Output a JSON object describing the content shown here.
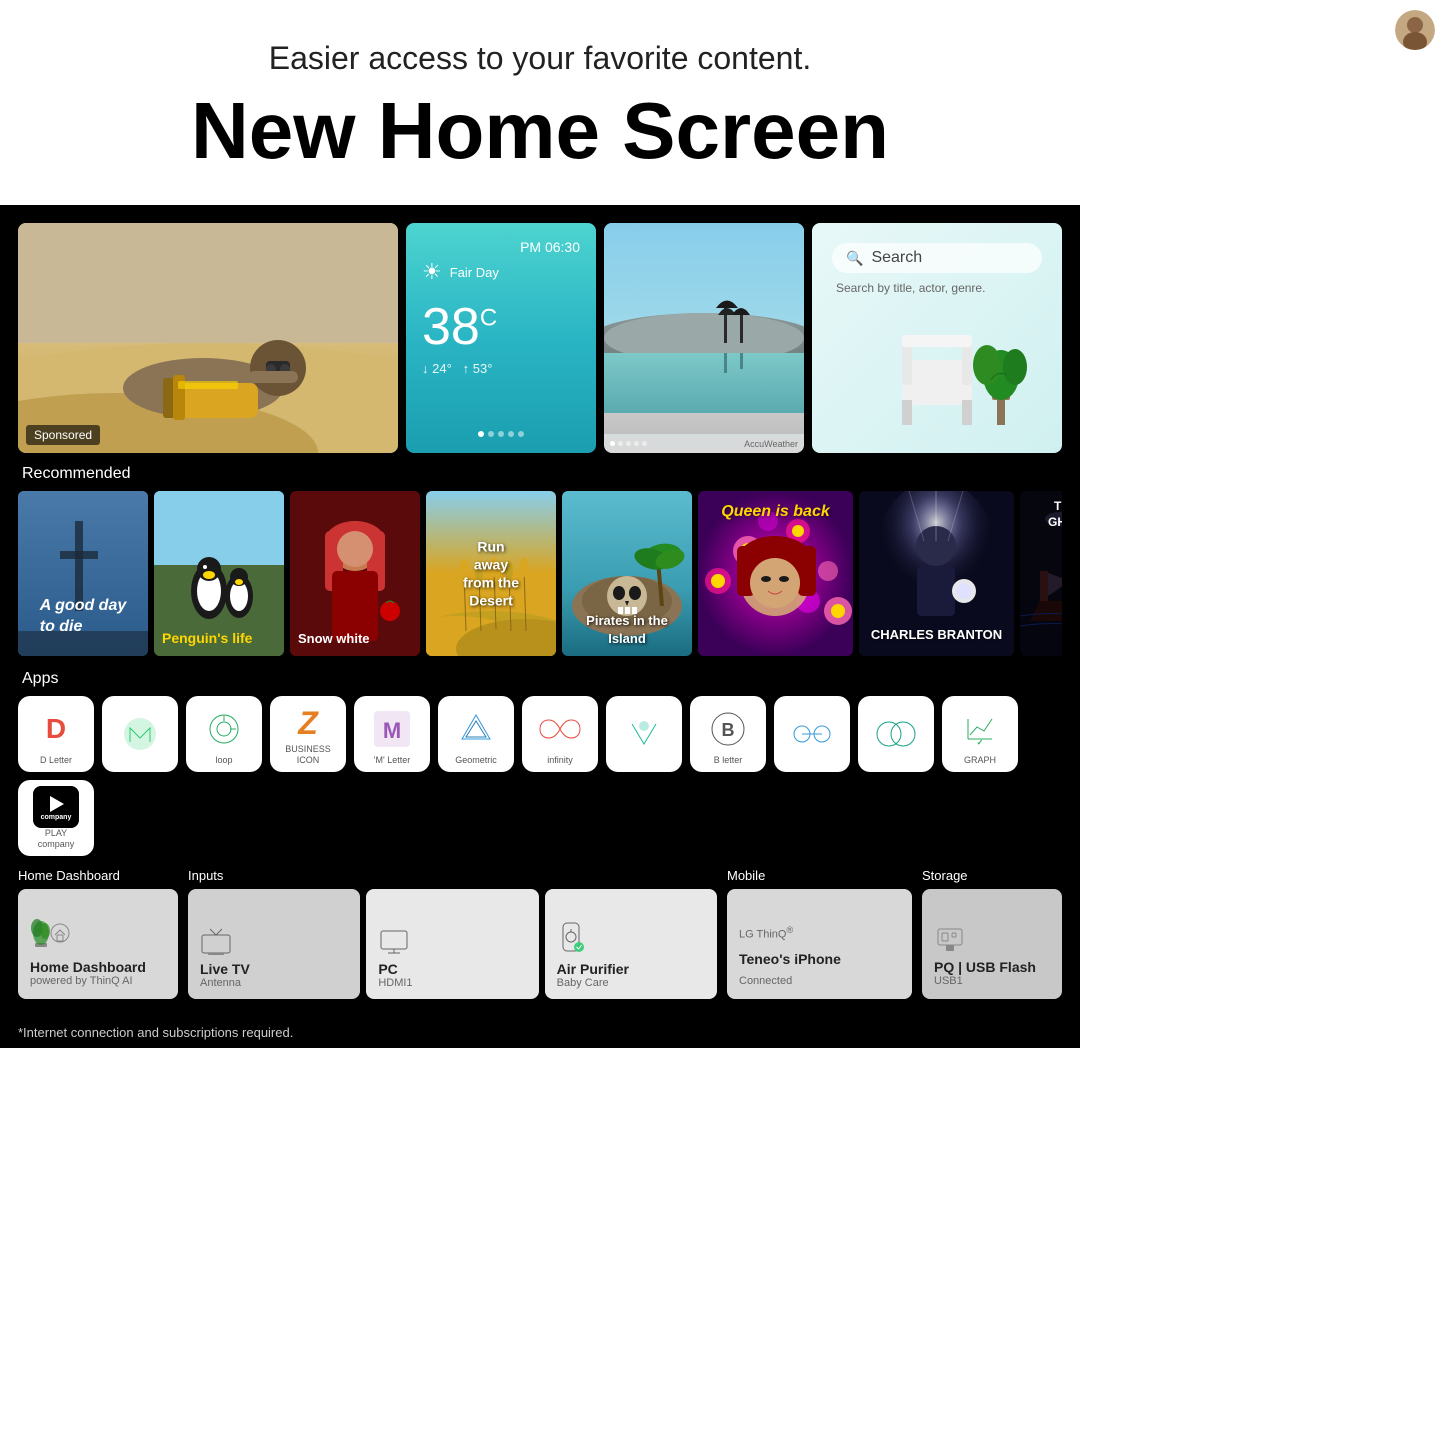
{
  "header": {
    "subtitle": "Easier access to your favorite content.",
    "title": "New Home Screen"
  },
  "widgets": {
    "featured": {
      "badge": "Sponsored"
    },
    "weather": {
      "time": "PM 06:30",
      "condition": "Fair Day",
      "temp": "38",
      "unit": "C",
      "low": "24°",
      "high": "53°"
    },
    "search": {
      "label": "Search",
      "hint": "Search by title, actor, genre."
    },
    "accu": "AccuWeather"
  },
  "sections": {
    "recommended_label": "Recommended",
    "apps_label": "Apps",
    "home_dashboard_label": "Home Dashboard",
    "inputs_label": "Inputs",
    "mobile_label": "Mobile",
    "storage_label": "Storage"
  },
  "recommended": [
    {
      "title": "A good day\nto die",
      "style": "card-1"
    },
    {
      "title": "Penguin's life",
      "style": "card-2"
    },
    {
      "title": "Snow white",
      "style": "card-3"
    },
    {
      "title": "Run away\nfrom the\nDesert",
      "style": "card-4"
    },
    {
      "title": "Pirates in the\nIsland",
      "style": "card-5"
    },
    {
      "title": "Queen is back",
      "style": "card-6"
    },
    {
      "title": "CHARLES BRANTON",
      "style": "card-7"
    },
    {
      "title": "THE DARK\nGHOST SHIP",
      "style": "card-8"
    }
  ],
  "apps": [
    {
      "id": "d-letter",
      "label": "D Letter",
      "icon": "D",
      "color": "#e74c3c"
    },
    {
      "id": "m-green",
      "label": "",
      "icon": "m",
      "color": "#2ecc71"
    },
    {
      "id": "loop",
      "label": "loop",
      "icon": "↺",
      "color": "#27ae60"
    },
    {
      "id": "business-icon",
      "label": "BUSINESS ICON",
      "icon": "Z",
      "color": "#e67e22"
    },
    {
      "id": "m-letter",
      "label": "'M' Letter",
      "icon": "M",
      "color": "#9b59b6"
    },
    {
      "id": "geometric",
      "label": "Geometric",
      "icon": "◇",
      "color": "#3498db"
    },
    {
      "id": "infinity",
      "label": "infinity",
      "icon": "∞",
      "color": "#e74c3c"
    },
    {
      "id": "v-app",
      "label": "",
      "icon": "V",
      "color": "#1abc9c"
    },
    {
      "id": "b-letter",
      "label": "B letter",
      "icon": "B",
      "color": "#555"
    },
    {
      "id": "chain",
      "label": "",
      "icon": "⛓",
      "color": "#3498db"
    },
    {
      "id": "rings",
      "label": "",
      "icon": "◎",
      "color": "#16a085"
    },
    {
      "id": "graph",
      "label": "GRAPH",
      "icon": "✓",
      "color": "#27ae60"
    },
    {
      "id": "play",
      "label": "PLAY\ncompany",
      "icon": "▶",
      "color": "#fff"
    }
  ],
  "home_dashboard": {
    "name": "Home Dashboard",
    "sub": "powered by ThinQ AI"
  },
  "inputs": [
    {
      "name": "Live TV",
      "sub": "Antenna",
      "icon": "⚡"
    },
    {
      "name": "PC",
      "sub": "HDMI1",
      "icon": "🖥"
    },
    {
      "name": "Air Purifier",
      "sub": "Baby Care",
      "icon": "🌀"
    }
  ],
  "mobile": {
    "brand": "LG ThinQ®",
    "name": "Teneo's iPhone",
    "sub": "Connected"
  },
  "storage": {
    "name": "PQ | USB Flash",
    "sub": "USB1"
  },
  "disclaimer": "*Internet connection and subscriptions required."
}
